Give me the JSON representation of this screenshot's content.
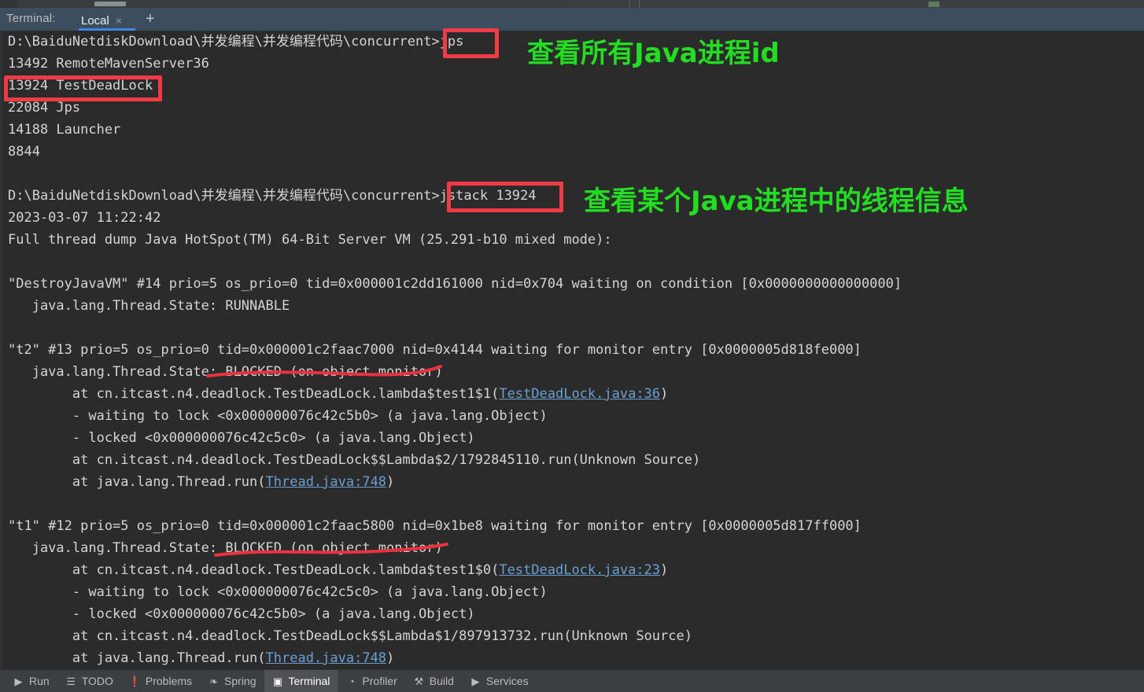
{
  "window": {
    "terminal_label": "Terminal:",
    "tab_name": "Local",
    "tab_close": "×",
    "add_tab": "+"
  },
  "terminal": {
    "lines": [
      {
        "id": "l1",
        "segments": [
          {
            "t": "D:\\BaiduNetdiskDownload\\并发编程\\并发编程代码\\concurrent>jps",
            "k": "plain"
          }
        ]
      },
      {
        "id": "l2",
        "segments": [
          {
            "t": "13492 RemoteMavenServer36",
            "k": "plain"
          }
        ]
      },
      {
        "id": "l3",
        "segments": [
          {
            "t": "13924 TestDeadLock",
            "k": "plain"
          }
        ]
      },
      {
        "id": "l4",
        "segments": [
          {
            "t": "22084 Jps",
            "k": "plain"
          }
        ]
      },
      {
        "id": "l5",
        "segments": [
          {
            "t": "14188 Launcher",
            "k": "plain"
          }
        ]
      },
      {
        "id": "l6",
        "segments": [
          {
            "t": "8844",
            "k": "plain"
          }
        ]
      },
      {
        "id": "l7",
        "segments": [
          {
            "t": "",
            "k": "plain"
          }
        ]
      },
      {
        "id": "l8",
        "segments": [
          {
            "t": "D:\\BaiduNetdiskDownload\\并发编程\\并发编程代码\\concurrent>jstack 13924",
            "k": "plain"
          }
        ]
      },
      {
        "id": "l9",
        "segments": [
          {
            "t": "2023-03-07 11:22:42",
            "k": "plain"
          }
        ]
      },
      {
        "id": "l10",
        "segments": [
          {
            "t": "Full thread dump Java HotSpot(TM) 64-Bit Server VM (25.291-b10 mixed mode):",
            "k": "plain"
          }
        ]
      },
      {
        "id": "l11",
        "segments": [
          {
            "t": "",
            "k": "plain"
          }
        ]
      },
      {
        "id": "l12",
        "segments": [
          {
            "t": "\"DestroyJavaVM\" #14 prio=5 os_prio=0 tid=0x000001c2dd161000 nid=0x704 waiting on condition [0x0000000000000000]",
            "k": "plain"
          }
        ]
      },
      {
        "id": "l13",
        "segments": [
          {
            "t": "   java.lang.Thread.State: RUNNABLE",
            "k": "plain"
          }
        ]
      },
      {
        "id": "l14",
        "segments": [
          {
            "t": "",
            "k": "plain"
          }
        ]
      },
      {
        "id": "l15",
        "segments": [
          {
            "t": "\"t2\" #13 prio=5 os_prio=0 tid=0x000001c2faac7000 nid=0x4144 waiting for monitor entry [0x0000005d818fe000]",
            "k": "plain"
          }
        ]
      },
      {
        "id": "l16",
        "segments": [
          {
            "t": "   java.lang.Thread.State: BLOCKED (on object monitor)",
            "k": "plain"
          }
        ]
      },
      {
        "id": "l17",
        "segments": [
          {
            "t": "        at cn.itcast.n4.deadlock.TestDeadLock.lambda$test1$1(",
            "k": "plain"
          },
          {
            "t": "TestDeadLock.java:36",
            "k": "link"
          },
          {
            "t": ")",
            "k": "plain"
          }
        ]
      },
      {
        "id": "l18",
        "segments": [
          {
            "t": "        - waiting to lock <0x000000076c42c5b0> (a java.lang.Object)",
            "k": "plain"
          }
        ]
      },
      {
        "id": "l19",
        "segments": [
          {
            "t": "        - locked <0x000000076c42c5c0> (a java.lang.Object)",
            "k": "plain"
          }
        ]
      },
      {
        "id": "l20",
        "segments": [
          {
            "t": "        at cn.itcast.n4.deadlock.TestDeadLock$$Lambda$2/1792845110.run(Unknown Source)",
            "k": "plain"
          }
        ]
      },
      {
        "id": "l21",
        "segments": [
          {
            "t": "        at java.lang.Thread.run(",
            "k": "plain"
          },
          {
            "t": "Thread.java:748",
            "k": "link"
          },
          {
            "t": ")",
            "k": "plain"
          }
        ]
      },
      {
        "id": "l22",
        "segments": [
          {
            "t": "",
            "k": "plain"
          }
        ]
      },
      {
        "id": "l23",
        "segments": [
          {
            "t": "\"t1\" #12 prio=5 os_prio=0 tid=0x000001c2faac5800 nid=0x1be8 waiting for monitor entry [0x0000005d817ff000]",
            "k": "plain"
          }
        ]
      },
      {
        "id": "l24",
        "segments": [
          {
            "t": "   java.lang.Thread.State: BLOCKED (on object monitor)",
            "k": "plain"
          }
        ]
      },
      {
        "id": "l25",
        "segments": [
          {
            "t": "        at cn.itcast.n4.deadlock.TestDeadLock.lambda$test1$0(",
            "k": "plain"
          },
          {
            "t": "TestDeadLock.java:23",
            "k": "link"
          },
          {
            "t": ")",
            "k": "plain"
          }
        ]
      },
      {
        "id": "l26",
        "segments": [
          {
            "t": "        - waiting to lock <0x000000076c42c5c0> (a java.lang.Object)",
            "k": "plain"
          }
        ]
      },
      {
        "id": "l27",
        "segments": [
          {
            "t": "        - locked <0x000000076c42c5b0> (a java.lang.Object)",
            "k": "plain"
          }
        ]
      },
      {
        "id": "l28",
        "segments": [
          {
            "t": "        at cn.itcast.n4.deadlock.TestDeadLock$$Lambda$1/897913732.run(Unknown Source)",
            "k": "plain"
          }
        ]
      },
      {
        "id": "l29",
        "segments": [
          {
            "t": "        at java.lang.Thread.run(",
            "k": "plain"
          },
          {
            "t": "Thread.java:748",
            "k": "link"
          },
          {
            "t": ")",
            "k": "plain"
          }
        ]
      }
    ]
  },
  "annotations": {
    "note_jps": "查看所有Java进程id",
    "note_jstack": "查看某个Java进程中的线程信息",
    "box_color": "#f03a46",
    "note_color": "#22dd22"
  },
  "bottom_bar": {
    "items": [
      {
        "label": "Run",
        "icon": "▶",
        "name": "bottom-tab-run",
        "active": false
      },
      {
        "label": "TODO",
        "icon": "☰",
        "name": "bottom-tab-todo",
        "active": false
      },
      {
        "label": "Problems",
        "icon": "❗",
        "name": "bottom-tab-problems",
        "active": false
      },
      {
        "label": "Spring",
        "icon": "❧",
        "name": "bottom-tab-spring",
        "active": false
      },
      {
        "label": "Terminal",
        "icon": "▣",
        "name": "bottom-tab-terminal",
        "active": true
      },
      {
        "label": "Profiler",
        "icon": "◔",
        "name": "bottom-tab-profiler",
        "active": false
      },
      {
        "label": "Build",
        "icon": "⚒",
        "name": "bottom-tab-build",
        "active": false
      },
      {
        "label": "Services",
        "icon": "▶",
        "name": "bottom-tab-services",
        "active": false
      }
    ]
  }
}
